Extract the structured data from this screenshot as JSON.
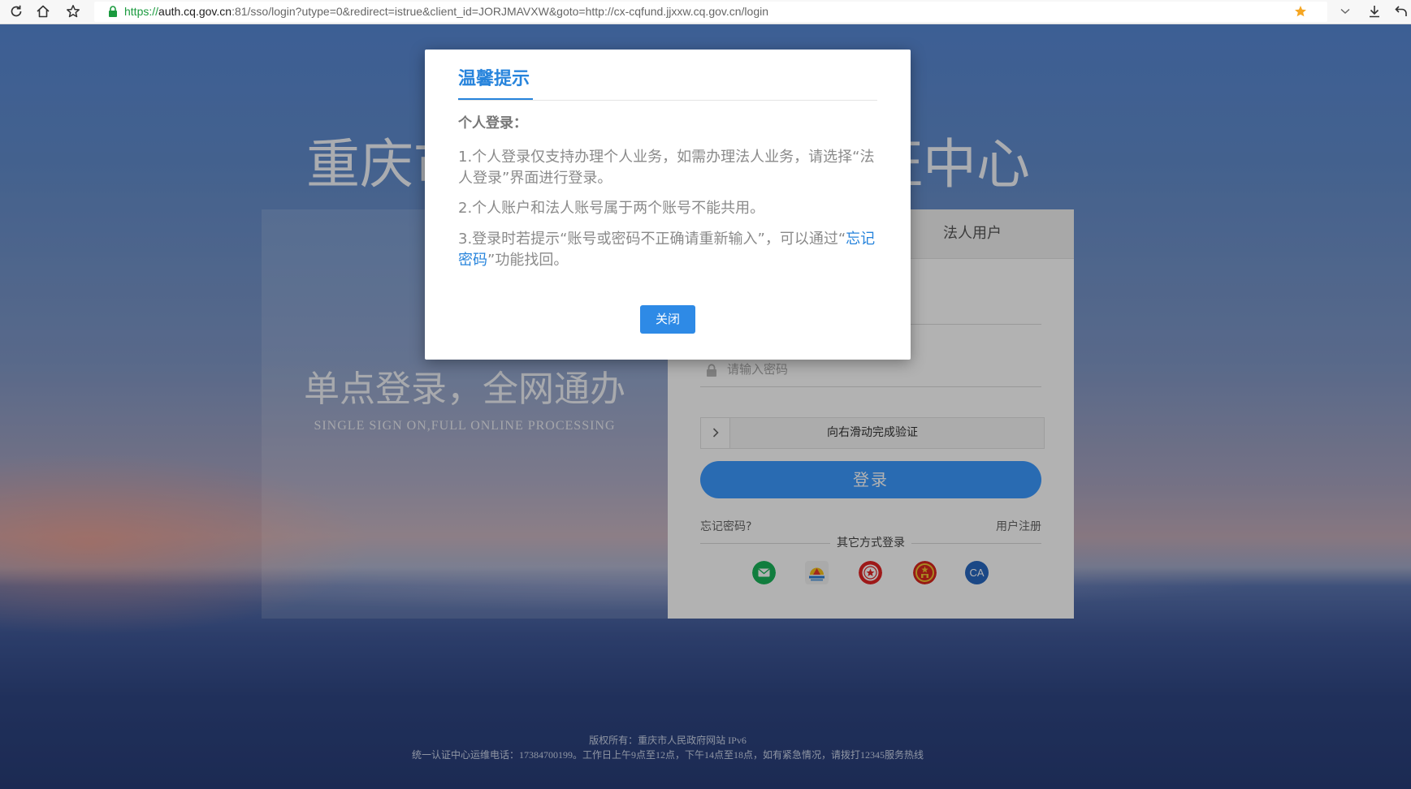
{
  "browser": {
    "url_scheme": "https://",
    "url_host": "auth.cq.gov.cn",
    "url_rest": ":81/sso/login?utype=0&redirect=istrue&client_id=JORJMAVXW&goto=http://cx-cqfund.jjxxw.cq.gov.cn/login",
    "icons": [
      "reload-icon",
      "home-icon",
      "bookmark-star-icon",
      "lock-icon",
      "bookmarked-star-icon",
      "chevron-down-icon",
      "download-icon",
      "undo-icon"
    ]
  },
  "page": {
    "title_left": "重庆市",
    "title_right": "证中心"
  },
  "login": {
    "slogan": "单点登录，全网通办",
    "slogan_en": "SINGLE SIGN ON,FULL ONLINE PROCESSING",
    "tab_corporate": "法人用户",
    "password_placeholder": "请输入密码",
    "slider_text": "向右滑动完成验证",
    "login_button": "登录",
    "forgot_password": "忘记密码?",
    "register": "用户注册",
    "other_login": "其它方式登录",
    "other_login_icons": [
      "email-icon",
      "app-logo-icon",
      "seal-icon",
      "emblem-icon",
      "ca-icon"
    ],
    "ca_label": "CA"
  },
  "footer": {
    "copyright": "版权所有：重庆市人民政府网站 IPv6",
    "hotline": "统一认证中心运维电话：17384700199。工作日上午9点至12点，下午14点至18点，如有紧急情况，请拨打12345服务热线"
  },
  "modal": {
    "title": "温馨提示",
    "section": "个人登录：",
    "items": [
      {
        "text": "1.个人登录仅支持办理个人业务，如需办理法人业务，请选择“法人登录”界面进行登录。"
      },
      {
        "text": "2.个人账户和法人账号属于两个账号不能共用。"
      },
      {
        "before": "3.登录时若提示“账号或密码不正确请重新输入”，可以通过“",
        "link": "忘记密码",
        "after": "”功能找回。"
      }
    ],
    "close_button": "关闭"
  },
  "colors": {
    "accent": "#2784dc",
    "login_button": "#3c9aff",
    "secure_green": "#1a9a3e",
    "bookmark_star": "#f5a623"
  }
}
